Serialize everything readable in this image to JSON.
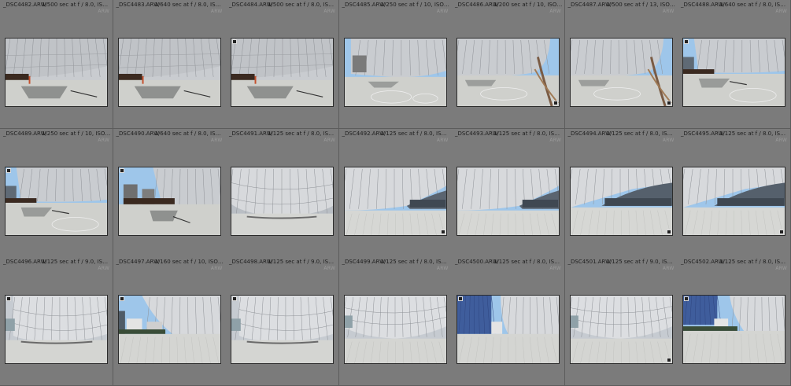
{
  "grid": {
    "columns": 7,
    "items": [
      {
        "file": "_DSC4482.ARW",
        "meta": "1/500 sec at f / 8.0, ISO 100, 35...",
        "format": "ARW",
        "scene": "a",
        "badge_tl": false,
        "badge_br": false
      },
      {
        "file": "_DSC4483.ARW",
        "meta": "1/640 sec at f / 8.0, ISO 100, 35...",
        "format": "ARW",
        "scene": "a",
        "badge_tl": false,
        "badge_br": false
      },
      {
        "file": "_DSC4484.ARW",
        "meta": "1/500 sec at f / 8.0, ISO 100, 35...",
        "format": "ARW",
        "scene": "a",
        "badge_tl": true,
        "badge_br": false
      },
      {
        "file": "_DSC4485.ARW",
        "meta": "1/250 sec at f / 10, ISO 100, 24 m...",
        "format": "ARW",
        "scene": "b",
        "badge_tl": false,
        "badge_br": false
      },
      {
        "file": "_DSC4486.ARW",
        "meta": "1/200 sec at f / 10, ISO 100, 35 m...",
        "format": "ARW",
        "scene": "c",
        "badge_tl": false,
        "badge_br": true
      },
      {
        "file": "_DSC4487.ARW",
        "meta": "1/500 sec at f / 13, ISO 100, 35 m...",
        "format": "ARW",
        "scene": "c",
        "badge_tl": false,
        "badge_br": true
      },
      {
        "file": "_DSC4488.ARW",
        "meta": "1/640 sec at f / 8.0, ISO 100, 35...",
        "format": "ARW",
        "scene": "d",
        "badge_tl": true,
        "badge_br": false
      },
      {
        "file": "_DSC4489.ARW",
        "meta": "1/250 sec at f / 10, ISO 100, 26 m...",
        "format": "ARW",
        "scene": "d",
        "badge_tl": true,
        "badge_br": false
      },
      {
        "file": "_DSC4490.ARW",
        "meta": "1/640 sec at f / 8.0, ISO 100, 35...",
        "format": "ARW",
        "scene": "e",
        "badge_tl": true,
        "badge_br": false
      },
      {
        "file": "_DSC4491.ARW",
        "meta": "1/125 sec at f / 8.0, ISO 100, 24 m...",
        "format": "ARW",
        "scene": "f",
        "badge_tl": false,
        "badge_br": false
      },
      {
        "file": "_DSC4492.ARW",
        "meta": "1/125 sec at f / 8.0, ISO 100, 24 m...",
        "format": "ARW",
        "scene": "g",
        "badge_tl": false,
        "badge_br": true
      },
      {
        "file": "_DSC4493.ARW",
        "meta": "1/125 sec at f / 8.0, ISO 100, 24 m...",
        "format": "ARW",
        "scene": "g",
        "badge_tl": false,
        "badge_br": false
      },
      {
        "file": "_DSC4494.ARW",
        "meta": "1/125 sec at f / 8.0, ISO 100, 35 m...",
        "format": "ARW",
        "scene": "h",
        "badge_tl": false,
        "badge_br": true
      },
      {
        "file": "_DSC4495.ARW",
        "meta": "1/125 sec at f / 8.0, ISO 100, 35 m...",
        "format": "ARW",
        "scene": "h",
        "badge_tl": false,
        "badge_br": true
      },
      {
        "file": "_DSC4496.ARW",
        "meta": "1/125 sec at f / 9.0, ISO 100, 35 m...",
        "format": "ARW",
        "scene": "i",
        "badge_tl": true,
        "badge_br": false
      },
      {
        "file": "_DSC4497.ARW",
        "meta": "1/160 sec at f / 10, ISO 100, 35 m...",
        "format": "ARW",
        "scene": "j",
        "badge_tl": true,
        "badge_br": false
      },
      {
        "file": "_DSC4498.ARW",
        "meta": "1/125 sec at f / 9.0, ISO 100, 35 m...",
        "format": "ARW",
        "scene": "i",
        "badge_tl": true,
        "badge_br": false
      },
      {
        "file": "_DSC4499.ARW",
        "meta": "1/125 sec at f / 8.0, ISO 100, 24 m...",
        "format": "ARW",
        "scene": "k",
        "badge_tl": false,
        "badge_br": false
      },
      {
        "file": "_DSC4500.ARW",
        "meta": "1/125 sec at f / 8.0, ISO 100, 35 m...",
        "format": "ARW",
        "scene": "l",
        "badge_tl": true,
        "badge_br": false
      },
      {
        "file": "_DSC4501.ARW",
        "meta": "1/125 sec at f / 9.0, ISO 100, 24 m...",
        "format": "ARW",
        "scene": "k",
        "badge_tl": false,
        "badge_br": true
      },
      {
        "file": "_DSC4502.ARW",
        "meta": "1/125 sec at f / 8.0, ISO 100, 35 m...",
        "format": "ARW",
        "scene": "m",
        "badge_tl": true,
        "badge_br": false
      }
    ]
  },
  "colors": {
    "cell_bg": "#7b7b7b",
    "gutter": "#5a5a5a",
    "sky": "#9ec6ea",
    "facade": "#c9ccd0",
    "ground": "#cfd0cc"
  }
}
